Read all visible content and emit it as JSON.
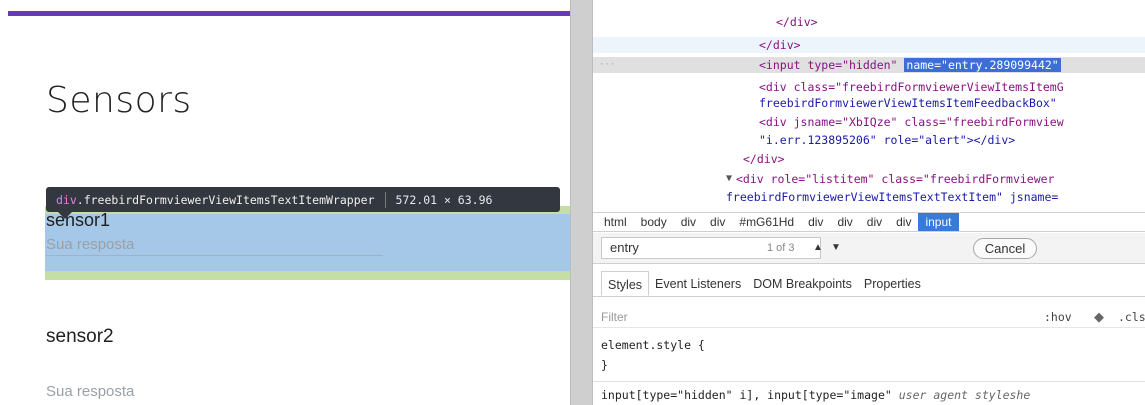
{
  "form": {
    "title": "Sensors",
    "question1_label": "sensor1",
    "question1_hint": "Sua resposta",
    "question2_label": "sensor2",
    "question2_hint": "Sua resposta",
    "accent_color": "#673ab7"
  },
  "tooltip": {
    "tag": "div",
    "class_name": ".freebirdFormviewerViewItemsTextItemWrapper",
    "size": "572.01 × 63.96"
  },
  "dom_tree": {
    "line0": "</div>",
    "line1": "</div>",
    "line2_a": "<input type=\"hidden\" ",
    "line2_b": "name=\"entry.289099442\"",
    "line3": "<div class=\"freebirdFormviewerViewItemsItemG",
    "line4": "freebirdFormviewerViewItemsItemFeedbackBox\"",
    "line5": "<div jsname=\"XbIQze\" class=\"freebirdFormview",
    "line6": "\"i.err.123895206\" role=\"alert\"></div>",
    "line7": "</div>",
    "line8": "<div role=\"listitem\" class=\"freebirdFormviewer",
    "line9": "freebirdFormviewerViewItemsTextTextItem\" jsname="
  },
  "breadcrumbs": [
    "html",
    "body",
    "div",
    "div",
    "#mG61Hd",
    "div",
    "div",
    "div",
    "div",
    "input"
  ],
  "search": {
    "value": "entry",
    "match_count": "1 of 3",
    "cancel_label": "Cancel"
  },
  "tabs": [
    "Styles",
    "Event Listeners",
    "DOM Breakpoints",
    "Properties"
  ],
  "filter": {
    "placeholder": "Filter",
    "hov_label": ":hov",
    "cls_label": ".cls"
  },
  "styles": {
    "element_style_open": "element.style {",
    "element_style_close": "}",
    "ua_selector": "input[type=\"hidden\" i], input[type=\"image\"",
    "ua_note": "user agent styleshe"
  }
}
